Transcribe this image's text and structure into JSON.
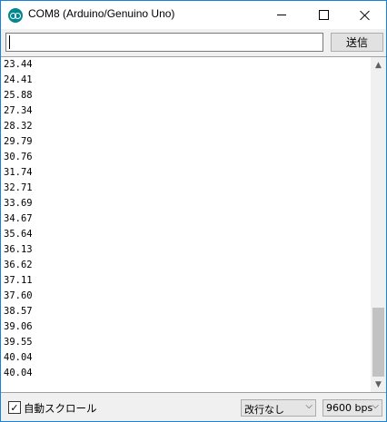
{
  "window": {
    "title": "COM8 (Arduino/Genuino Uno)"
  },
  "input": {
    "value": "",
    "send_label": "送信"
  },
  "output": {
    "lines": [
      "23.44",
      "24.41",
      "25.88",
      "27.34",
      "28.32",
      "29.79",
      "30.76",
      "31.74",
      "32.71",
      "33.69",
      "34.67",
      "35.64",
      "36.13",
      "36.62",
      "37.11",
      "37.60",
      "38.57",
      "39.06",
      "39.55",
      "40.04",
      "40.04"
    ]
  },
  "footer": {
    "autoscroll_label": "自動スクロール",
    "autoscroll_checked": "✓",
    "line_ending": "改行なし",
    "baud_rate": "9600 bps"
  },
  "icons": {
    "app": "arduino-icon",
    "minimize": "minimize-icon",
    "maximize": "maximize-icon",
    "close": "close-icon",
    "dropdown": "chevron-down-icon"
  },
  "colors": {
    "window_border": "#1883d7",
    "app_icon": "#00878f"
  }
}
